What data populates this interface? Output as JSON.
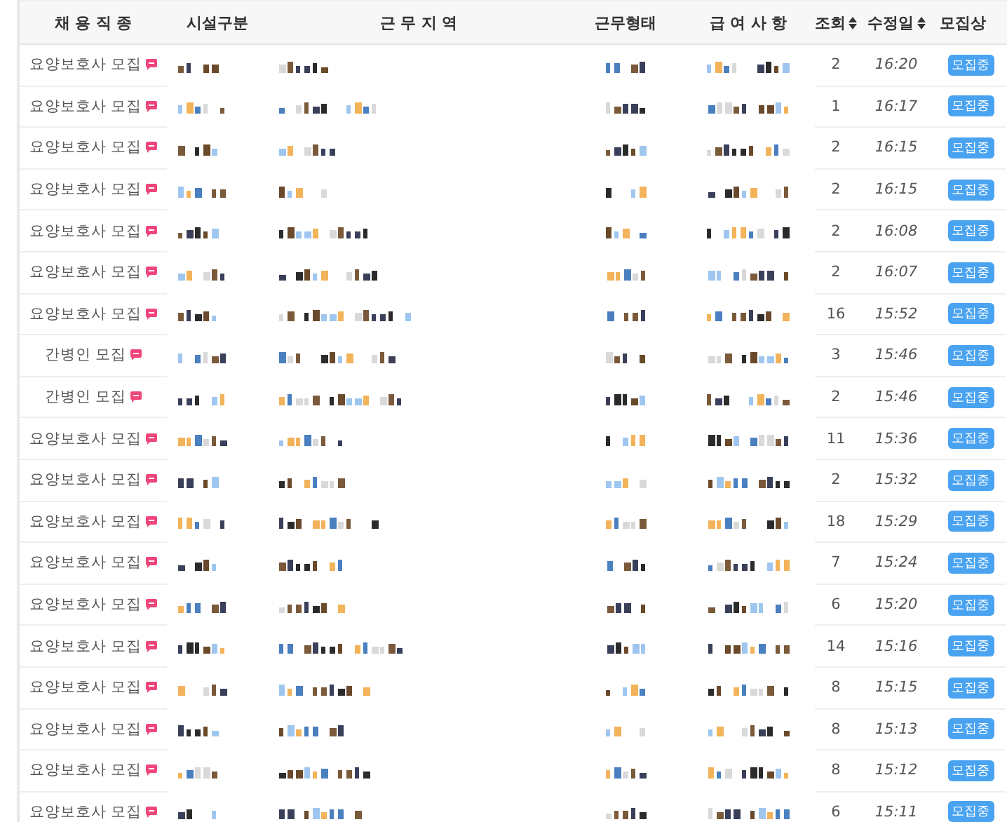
{
  "table": {
    "columns": [
      {
        "label": "채 용 직 종",
        "sortable": false
      },
      {
        "label": "시설구분",
        "sortable": false
      },
      {
        "label": "근 무 지 역",
        "sortable": false
      },
      {
        "label": "근무형태",
        "sortable": false
      },
      {
        "label": "급 여 사 항",
        "sortable": false
      },
      {
        "label": "조회",
        "sortable": true
      },
      {
        "label": "수정일",
        "sortable": true
      },
      {
        "label": "모집상",
        "sortable": false
      }
    ],
    "rows": [
      {
        "job": "요양보호사 모집",
        "views": "2",
        "updated": "16:20",
        "status": "모집중"
      },
      {
        "job": "요양보호사 모집",
        "views": "1",
        "updated": "16:17",
        "status": "모집중"
      },
      {
        "job": "요양보호사 모집",
        "views": "2",
        "updated": "16:15",
        "status": "모집중"
      },
      {
        "job": "요양보호사 모집",
        "views": "2",
        "updated": "16:15",
        "status": "모집중"
      },
      {
        "job": "요양보호사 모집",
        "views": "2",
        "updated": "16:08",
        "status": "모집중"
      },
      {
        "job": "요양보호사 모집",
        "views": "2",
        "updated": "16:07",
        "status": "모집중"
      },
      {
        "job": "요양보호사 모집",
        "views": "16",
        "updated": "15:52",
        "status": "모집중"
      },
      {
        "job": "간병인 모집",
        "views": "3",
        "updated": "15:46",
        "status": "모집중"
      },
      {
        "job": "간병인 모집",
        "views": "2",
        "updated": "15:46",
        "status": "모집중"
      },
      {
        "job": "요양보호사 모집",
        "views": "11",
        "updated": "15:36",
        "status": "모집중"
      },
      {
        "job": "요양보호사 모집",
        "views": "2",
        "updated": "15:32",
        "status": "모집중"
      },
      {
        "job": "요양보호사 모집",
        "views": "18",
        "updated": "15:29",
        "status": "모집중"
      },
      {
        "job": "요양보호사 모집",
        "views": "7",
        "updated": "15:24",
        "status": "모집중"
      },
      {
        "job": "요양보호사 모집",
        "views": "6",
        "updated": "15:20",
        "status": "모집중"
      },
      {
        "job": "요양보호사 모집",
        "views": "14",
        "updated": "15:16",
        "status": "모집중"
      },
      {
        "job": "요양보호사 모집",
        "views": "8",
        "updated": "15:15",
        "status": "모집중"
      },
      {
        "job": "요양보호사 모집",
        "views": "8",
        "updated": "15:13",
        "status": "모집중"
      },
      {
        "job": "요양보호사 모집",
        "views": "8",
        "updated": "15:12",
        "status": "모집중"
      },
      {
        "job": "요양보호사 모집",
        "views": "6",
        "updated": "15:11",
        "status": "모집중"
      }
    ]
  }
}
